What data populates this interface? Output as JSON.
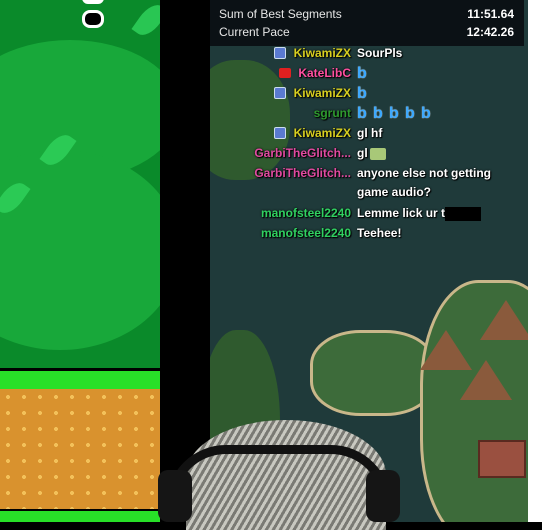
{
  "splits": {
    "rows": [
      {
        "label": "Sum of Best Segments",
        "value": "11:51.64"
      },
      {
        "label": "Current Pace",
        "value": "12:42.26"
      }
    ]
  },
  "chat": {
    "messages": [
      {
        "name": "KiwamiZX",
        "name_color": "#d8d020",
        "badge": "prime-badge",
        "text": "SourPls"
      },
      {
        "name": "KateLibC",
        "name_color": "#ff4fa0",
        "badge": "youtube-badge",
        "emotes": 1,
        "text": ""
      },
      {
        "name": "KiwamiZX",
        "name_color": "#d8d020",
        "badge": "prime-badge",
        "emotes": 1,
        "text": ""
      },
      {
        "name": "sgrunt",
        "name_color": "#2e9a2e",
        "badge": "",
        "emotes": 5,
        "text": ""
      },
      {
        "name": "KiwamiZX",
        "name_color": "#d8d020",
        "badge": "prime-badge",
        "text": "gl hf"
      },
      {
        "name": "GarbiTheGlitch...",
        "name_color": "#e04aa0",
        "badge": "",
        "text": "gl"
      },
      {
        "name": "GarbiTheGlitch...",
        "name_color": "#e04aa0",
        "badge": "",
        "text": "anyone else not getting game audio?"
      },
      {
        "name": "manofsteel2240",
        "name_color": "#30d060",
        "badge": "",
        "text": "Lemme lick ur t"
      },
      {
        "name": "manofsteel2240",
        "name_color": "#30d060",
        "badge": "",
        "text": "Teehee!"
      }
    ]
  }
}
